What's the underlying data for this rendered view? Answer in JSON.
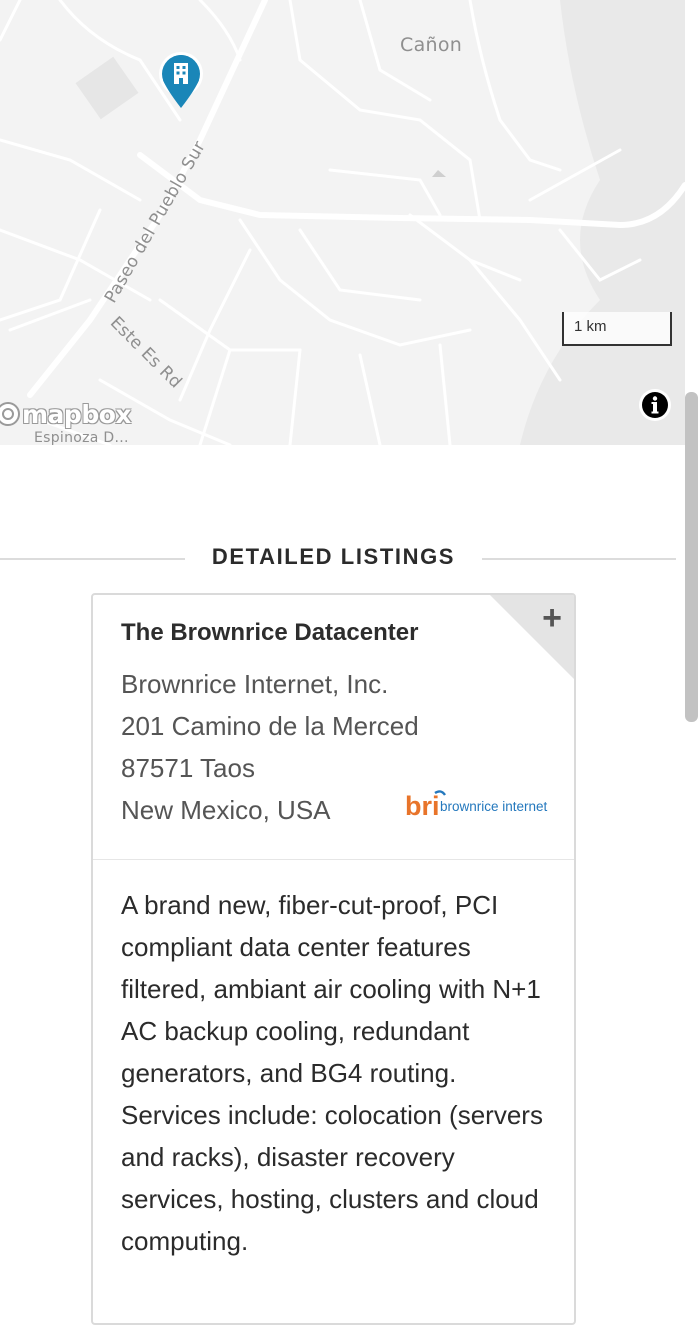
{
  "map": {
    "labels": {
      "canon": "Cañon",
      "paseo": "Paseo del Pueblo Sur",
      "este_es": "Este Es Rd",
      "espinoza": "Espinoza D..."
    },
    "scale_label": "1 km",
    "attribution_logo": "mapbox",
    "marker_icon": "building-icon",
    "info_icon": "info-icon"
  },
  "section": {
    "title": "DETAILED LISTINGS"
  },
  "listing": {
    "name": "The Brownrice Datacenter",
    "company": "Brownrice Internet, Inc.",
    "street": "201 Camino de la Merced",
    "city": "87571 Taos",
    "region": "New Mexico, USA",
    "logo_mark": "bri",
    "logo_text": "brownrice internet",
    "expand_icon": "plus-icon",
    "description": "A brand new, fiber-cut-proof, PCI compliant data center features filtered, ambiant air cooling with N+1 AC backup cooling, redundant generators, and BG4 routing. Services include: colocation (servers and racks), disaster recovery services, hosting, clusters and cloud computing."
  },
  "colors": {
    "marker": "#1a86b8",
    "logo_orange": "#e8742a",
    "logo_blue": "#2478bd"
  }
}
